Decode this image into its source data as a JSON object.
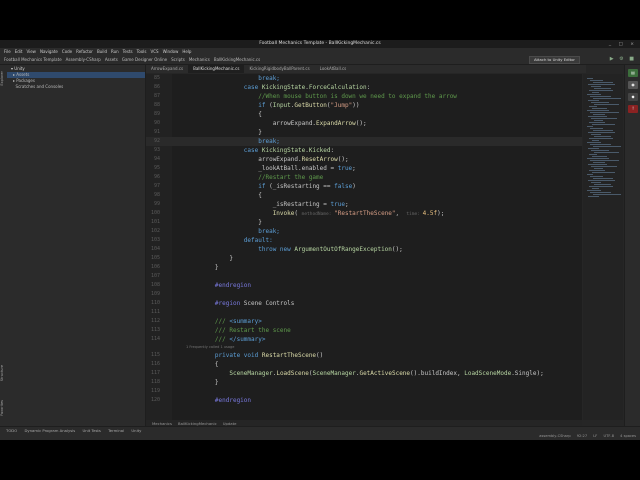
{
  "window": {
    "title": "Football Mechanics Template - BallKickingMechanic.cs",
    "controls": "_ □ ×"
  },
  "menu": [
    "File",
    "Edit",
    "View",
    "Navigate",
    "Code",
    "Refactor",
    "Build",
    "Run",
    "Tests",
    "Tools",
    "VCS",
    "Window",
    "Help"
  ],
  "nav": {
    "crumbs": [
      "Football Mechanics Template",
      "Assembly-CSharp",
      "Assets",
      "Game Designer Online",
      "Scripts",
      "Mechanics",
      "BallKickingMechanic.cs"
    ],
    "run_config": "Attach to Unity Editor"
  },
  "explorer": {
    "header": "Unity",
    "items": [
      "Assets",
      "Packages",
      "Scratches and Consoles"
    ]
  },
  "left_tabs": [
    "Explorer",
    "Unity",
    "Structure",
    "Favorites"
  ],
  "tabs": [
    "ArrowExpand.cs",
    "BallKickingMechanic.cs",
    "KickingRigidbodyBallParent.cs",
    "LookAtBall.cs"
  ],
  "editor": {
    "hint_refs": "1 Frequently called    1 usage",
    "lines": [
      {
        "n": "85",
        "segs": [
          [
            "kw",
            "                    break;"
          ]
        ]
      },
      {
        "n": "86",
        "segs": [
          [
            "kw",
            "                case "
          ],
          [
            "ty",
            "KickingState"
          ],
          [
            "id",
            "."
          ],
          [
            "ty",
            "ForceCalculation"
          ],
          [
            "id",
            ":"
          ]
        ]
      },
      {
        "n": "87",
        "segs": [
          [
            "cm",
            "                    //When mouse button is down we need to expand the arrow"
          ]
        ]
      },
      {
        "n": "88",
        "segs": [
          [
            "kw",
            "                    if "
          ],
          [
            "id",
            "("
          ],
          [
            "ty",
            "Input"
          ],
          [
            "id",
            "."
          ],
          [
            "fn",
            "GetButton"
          ],
          [
            "id",
            "("
          ],
          [
            "st",
            "\"Jump\""
          ],
          [
            "id",
            "))"
          ]
        ]
      },
      {
        "n": "89",
        "segs": [
          [
            "id",
            "                    {"
          ]
        ]
      },
      {
        "n": "90",
        "segs": [
          [
            "id",
            "                        arrowExpand."
          ],
          [
            "fn",
            "ExpandArrow"
          ],
          [
            "id",
            "();"
          ]
        ]
      },
      {
        "n": "91",
        "segs": [
          [
            "id",
            "                    }"
          ]
        ]
      },
      {
        "n": "92",
        "segs": [
          [
            "kw",
            "                    break;"
          ]
        ]
      },
      {
        "n": "93",
        "segs": [
          [
            "kw",
            "                case "
          ],
          [
            "ty",
            "KickingState"
          ],
          [
            "id",
            "."
          ],
          [
            "ty",
            "Kicked"
          ],
          [
            "id",
            ":"
          ]
        ]
      },
      {
        "n": "94",
        "segs": [
          [
            "id",
            "                    arrowExpand."
          ],
          [
            "fn",
            "ResetArrow"
          ],
          [
            "id",
            "();"
          ]
        ]
      },
      {
        "n": "95",
        "segs": [
          [
            "id",
            "                    _lookAtBall.enabled = "
          ],
          [
            "kw",
            "true"
          ],
          [
            "id",
            ";"
          ]
        ]
      },
      {
        "n": "96",
        "segs": [
          [
            "cm",
            "                    //Restart the game"
          ]
        ]
      },
      {
        "n": "97",
        "segs": [
          [
            "kw",
            "                    if "
          ],
          [
            "id",
            "(_isRestarting == "
          ],
          [
            "kw",
            "false"
          ],
          [
            "id",
            ")"
          ]
        ]
      },
      {
        "n": "98",
        "segs": [
          [
            "id",
            "                    {"
          ]
        ]
      },
      {
        "n": "99",
        "segs": [
          [
            "id",
            "                        _isRestarting = "
          ],
          [
            "kw",
            "true"
          ],
          [
            "id",
            ";"
          ]
        ]
      },
      {
        "n": "100",
        "segs": [
          [
            "fn",
            "                        Invoke"
          ],
          [
            "id",
            "( "
          ],
          [
            "pm",
            "methodName: "
          ],
          [
            "st",
            "\"RestartTheScene\""
          ],
          [
            "id",
            ",  "
          ],
          [
            "pm",
            "time: "
          ],
          [
            "pr",
            "4.5f"
          ],
          [
            "id",
            ");"
          ]
        ]
      },
      {
        "n": "101",
        "segs": [
          [
            "id",
            "                    }"
          ]
        ]
      },
      {
        "n": "102",
        "segs": [
          [
            "kw",
            "                    break;"
          ]
        ]
      },
      {
        "n": "103",
        "segs": [
          [
            "kw",
            "                default:"
          ]
        ]
      },
      {
        "n": "104",
        "segs": [
          [
            "kw",
            "                    throw new "
          ],
          [
            "ty",
            "ArgumentOutOfRangeException"
          ],
          [
            "id",
            "();"
          ]
        ]
      },
      {
        "n": "105",
        "segs": [
          [
            "id",
            "            }"
          ]
        ]
      },
      {
        "n": "106",
        "segs": [
          [
            "id",
            "        }"
          ]
        ]
      },
      {
        "n": "107",
        "segs": [
          [
            "id",
            ""
          ]
        ]
      },
      {
        "n": "108",
        "segs": [
          [
            "rg",
            "        #endregion"
          ]
        ]
      },
      {
        "n": "109",
        "segs": [
          [
            "id",
            ""
          ]
        ]
      },
      {
        "n": "110",
        "segs": [
          [
            "rg",
            "        #region "
          ],
          [
            "id",
            "Scene Controls"
          ]
        ]
      },
      {
        "n": "111",
        "segs": [
          [
            "id",
            ""
          ]
        ]
      },
      {
        "n": "112",
        "segs": [
          [
            "cm",
            "        /// "
          ],
          [
            "kw",
            "<summary>"
          ]
        ]
      },
      {
        "n": "113",
        "segs": [
          [
            "cm",
            "        /// Restart the scene"
          ]
        ]
      },
      {
        "n": "114",
        "segs": [
          [
            "cm",
            "        /// "
          ],
          [
            "kw",
            "</summary>"
          ]
        ]
      },
      {
        "n": "115",
        "segs": [
          [
            "kw",
            "        private void "
          ],
          [
            "fn",
            "RestartTheScene"
          ],
          [
            "id",
            "()"
          ]
        ]
      },
      {
        "n": "116",
        "segs": [
          [
            "id",
            "        {"
          ]
        ]
      },
      {
        "n": "117",
        "segs": [
          [
            "ty",
            "            SceneManager"
          ],
          [
            "id",
            "."
          ],
          [
            "fn",
            "LoadScene"
          ],
          [
            "id",
            "("
          ],
          [
            "ty",
            "SceneManager"
          ],
          [
            "id",
            "."
          ],
          [
            "fn",
            "GetActiveScene"
          ],
          [
            "id",
            "().buildIndex, "
          ],
          [
            "ty",
            "LoadSceneMode"
          ],
          [
            "id",
            ".Single);"
          ]
        ]
      },
      {
        "n": "118",
        "segs": [
          [
            "id",
            "        }"
          ]
        ]
      },
      {
        "n": "119",
        "segs": [
          [
            "id",
            ""
          ]
        ]
      },
      {
        "n": "120",
        "segs": [
          [
            "rg",
            "        #endregion"
          ]
        ]
      }
    ]
  },
  "breadcrumb": [
    "Mechanics",
    "BallKickingMechanic",
    "Update"
  ],
  "bottom_tools": [
    "TODO",
    "Dynamic Program Analysis",
    "Unit Tests",
    "Terminal",
    "Unity"
  ],
  "status": {
    "left": "",
    "right": [
      "assembly-CSharp",
      "92:27",
      "LF",
      "UTF-8",
      "4 spaces"
    ]
  },
  "colors": {
    "bg": "#1e1e1e",
    "keyword": "#5c9ed6",
    "comment": "#5f9a4c",
    "string": "#d69d85",
    "accent": "#4a88c7"
  }
}
